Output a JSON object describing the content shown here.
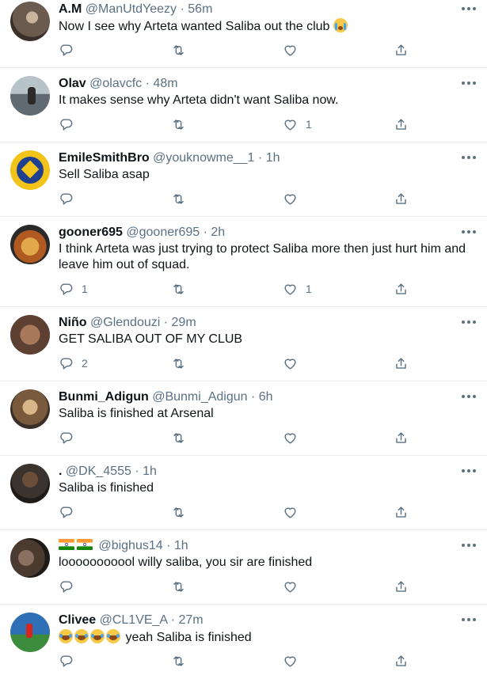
{
  "tweets": [
    {
      "name": "A.M",
      "handle": "@ManUtdYeezy",
      "time": "56m",
      "text": "Now I see why Arteta wanted Saliba out the club",
      "reply_count": "",
      "like_count": "",
      "avatar_color": "#6b5a4e",
      "emoji": "loudly-crying-face"
    },
    {
      "name": "Olav",
      "handle": "@olavcfc",
      "time": "48m",
      "text": "It makes sense why Arteta didn't want Saliba now.",
      "reply_count": "",
      "like_count": "1",
      "avatar_color": "#7d8a93"
    },
    {
      "name": "EmileSmithBro",
      "handle": "@youknowme__1",
      "time": "1h",
      "text": "Sell Saliba asap",
      "reply_count": "",
      "like_count": "",
      "avatar_color": "#1f3f8f"
    },
    {
      "name": "gooner695",
      "handle": "@gooner695",
      "time": "2h",
      "text": "I think Arteta was just trying to protect Saliba more then just hurt him and leave him out of squad.",
      "reply_count": "1",
      "like_count": "1",
      "avatar_color": "#c78a3a"
    },
    {
      "name": "Niño",
      "handle": "@Glendouzi",
      "time": "29m",
      "text": "GET SALIBA OUT OF MY CLUB",
      "reply_count": "2",
      "like_count": "",
      "avatar_color": "#5e4033"
    },
    {
      "name": "Bunmi_Adigun",
      "handle": "@Bunmi_Adigun",
      "time": "6h",
      "text": "Saliba is finished at Arsenal",
      "reply_count": "",
      "like_count": "",
      "avatar_color": "#7a5a3d"
    },
    {
      "name": ".",
      "handle": "@DK_4555",
      "time": "1h",
      "text": "Saliba is finished",
      "reply_count": "",
      "like_count": "",
      "avatar_color": "#3a332e"
    },
    {
      "name": "",
      "handle": "@bighus14",
      "time": "1h",
      "text": "looooooooool willy saliba, you sir are finished",
      "reply_count": "",
      "like_count": "",
      "avatar_color": "#4a3a30",
      "name_icons": [
        "india-flag-icon",
        "india-flag-icon"
      ]
    },
    {
      "name": "Clivee",
      "handle": "@CL1VE_A",
      "time": "27m",
      "text": "yeah Saliba is finished",
      "reply_count": "",
      "like_count": "",
      "avatar_color": "#2e6fb5",
      "text_prefix_icons": [
        "tears-of-joy-icon",
        "tears-of-joy-icon",
        "tears-of-joy-icon",
        "tears-of-joy-icon"
      ]
    }
  ],
  "icons": {
    "reply": "reply-icon",
    "retweet": "retweet-icon",
    "like": "like-icon",
    "share": "share-icon",
    "more": "more-options-icon"
  },
  "colors": {
    "text": "#0f1419",
    "secondary": "#5b7083",
    "divider": "#e6ecf0"
  }
}
